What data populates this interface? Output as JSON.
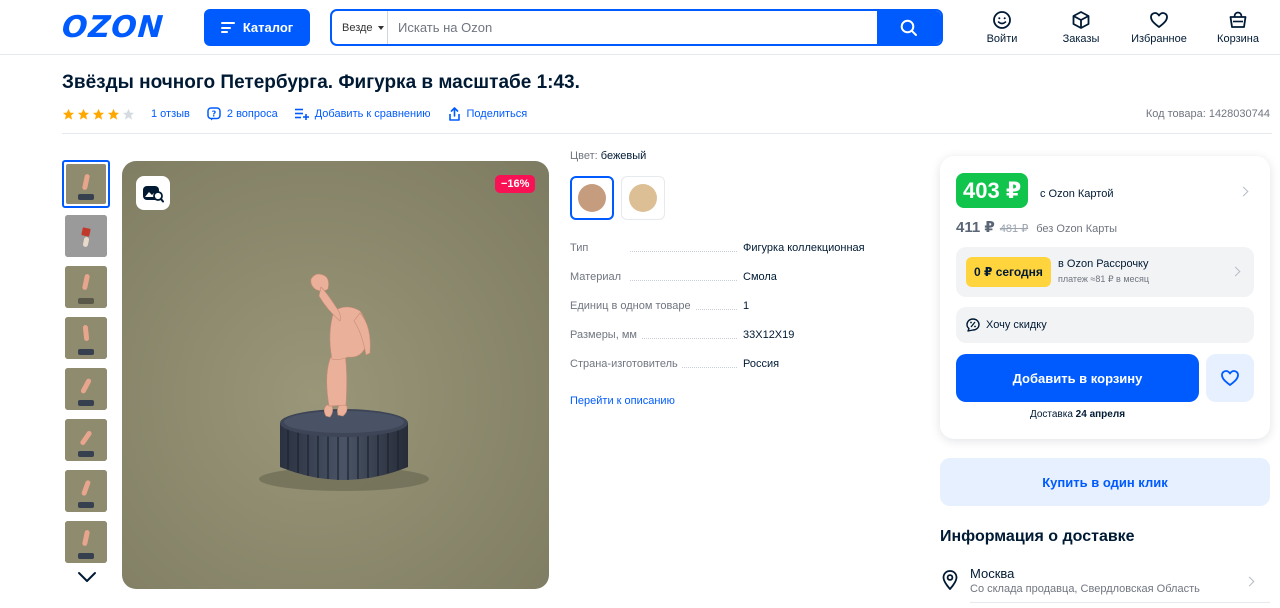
{
  "header": {
    "logo": "OZON",
    "catalog_label": "Каталог",
    "search_scope": "Везде",
    "search_placeholder": "Искать на Ozon",
    "nav": [
      {
        "label": "Войти",
        "icon": "user-face-icon"
      },
      {
        "label": "Заказы",
        "icon": "box-icon"
      },
      {
        "label": "Избранное",
        "icon": "heart-icon"
      },
      {
        "label": "Корзина",
        "icon": "cart-bag-icon"
      }
    ]
  },
  "product": {
    "title": "Звёзды ночного Петербурга. Фигурка в масштабе 1:43.",
    "rating": 4,
    "reviews": "1 отзыв",
    "questions": "2 вопроса",
    "compare": "Добавить к сравнению",
    "share": "Поделиться",
    "sku": "Код товара: 1428030744",
    "discount_badge": "−16%",
    "color_label": "Цвет:",
    "color_value": "бежевый",
    "colors": [
      "#c69c7e",
      "#dcbf95"
    ],
    "specs": [
      {
        "key": "Тип",
        "value": "Фигурка коллекционная"
      },
      {
        "key": "Материал",
        "value": "Смола"
      },
      {
        "key": "Единиц в одном товаре",
        "value": "1"
      },
      {
        "key": "Размеры, мм",
        "value": "33Х12Х19"
      },
      {
        "key": "Страна-изготовитель",
        "value": "Россия"
      }
    ],
    "to_description": "Перейти к описанию"
  },
  "buy": {
    "price_card": "403 ₽",
    "price_card_label": "с Ozon Картой",
    "price": "411 ₽",
    "old_price": "481 ₽",
    "price_label": "без Ozon Карты",
    "installment_badge": "0 ₽ сегодня",
    "installment_title": "в Ozon Рассрочку",
    "installment_sub": "платеж ≈81 ₽ в месяц",
    "want_discount": "Хочу скидку",
    "add_to_cart": "Добавить в корзину",
    "delivery_prefix": "Доставка",
    "delivery_date": "24 апреля",
    "one_click": "Купить в один клик"
  },
  "delivery": {
    "title": "Информация о доставке",
    "city": "Москва",
    "source": "Со склада продавца, Свердловская Область"
  },
  "colors": {
    "brand": "#005bff",
    "price_green": "#10c44c",
    "discount_red": "#f91155",
    "installment_yellow": "#ffd43d",
    "star": "#ffa800"
  }
}
